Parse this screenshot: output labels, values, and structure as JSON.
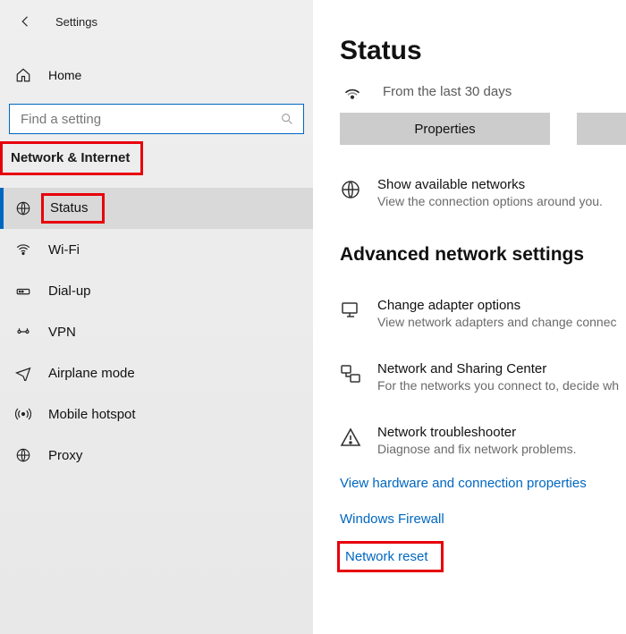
{
  "header": {
    "title": "Settings"
  },
  "sidebar": {
    "home_label": "Home",
    "search_placeholder": "Find a setting",
    "section_label": "Network & Internet",
    "items": [
      {
        "label": "Status"
      },
      {
        "label": "Wi-Fi"
      },
      {
        "label": "Dial-up"
      },
      {
        "label": "VPN"
      },
      {
        "label": "Airplane mode"
      },
      {
        "label": "Mobile hotspot"
      },
      {
        "label": "Proxy"
      }
    ]
  },
  "main": {
    "title": "Status",
    "connection_subtext": "From the last 30 days",
    "properties_btn": "Properties",
    "available": {
      "title": "Show available networks",
      "sub": "View the connection options around you."
    },
    "adv_title": "Advanced network settings",
    "adapter": {
      "title": "Change adapter options",
      "sub": "View network adapters and change connec"
    },
    "sharing": {
      "title": "Network and Sharing Center",
      "sub": "For the networks you connect to, decide wh"
    },
    "troubleshoot": {
      "title": "Network troubleshooter",
      "sub": "Diagnose and fix network problems."
    },
    "link_hw": "View hardware and connection properties",
    "link_fw": "Windows Firewall",
    "link_reset": "Network reset"
  }
}
